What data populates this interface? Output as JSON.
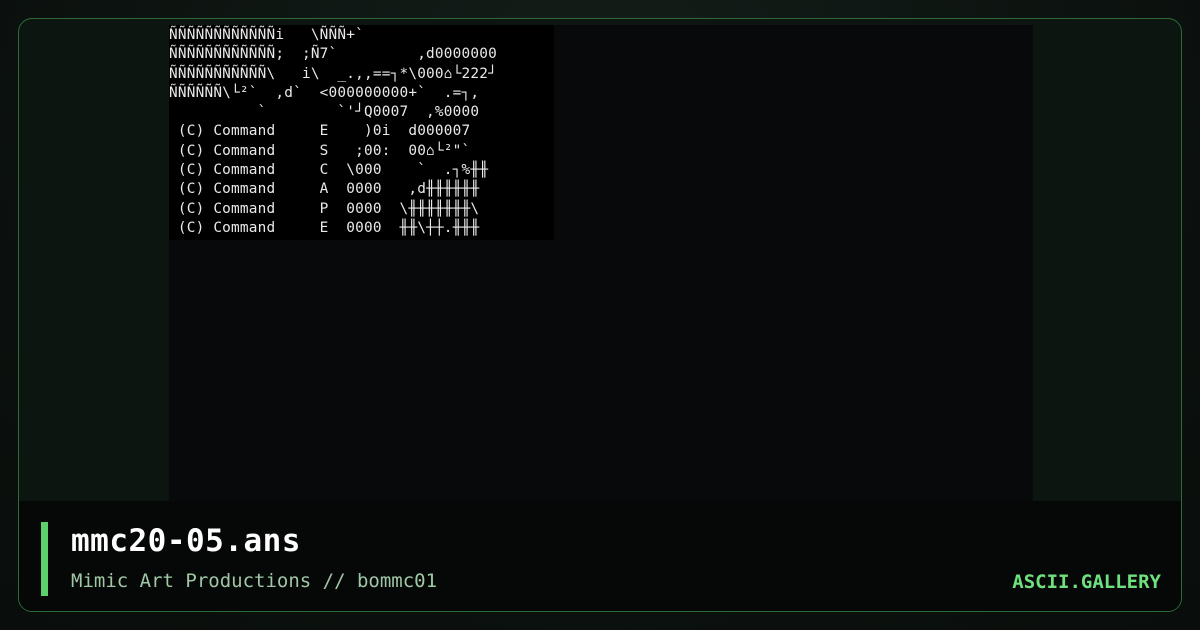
{
  "artwork": {
    "lines": [
      "ÑÑÑÑÑÑÑÑÑÑÑÑi   \\ÑÑÑ+`",
      "ÑÑÑÑÑÑÑÑÑÑÑÑ;  ;Ñ7`         ,d0000000",
      "ÑÑÑÑÑÑÑÑÑÑÑ\\   i\\  _.,,==┐*\\000⌂└222┘",
      "ÑÑÑÑÑÑ\\└²`  ,d`  <000000000+`  .=┐,",
      "          `        `'┘Q0007  ,%0000",
      " (C) Command     E    )0i  d000007",
      " (C) Command     S   ;00:  00⌂└²\"`",
      " (C) Command     C  \\000    `  .┐%╫╫",
      " (C) Command     A  0000   ,d╫╫╫╫╫╫",
      " (C) Command     P  0000  \\╫╫╫╫╫╫╫\\",
      " (C) Command     E  0000  ╫╫\\┼┼.╫╫╫"
    ]
  },
  "caption": {
    "title": "mmc20-05.ans",
    "subtitle": "Mimic Art Productions // bommc01",
    "brand": "ASCII.GALLERY"
  },
  "colors": {
    "accent": "#5cd06a",
    "brand": "#6fe07e",
    "frame_border": "#2f6a3a"
  }
}
